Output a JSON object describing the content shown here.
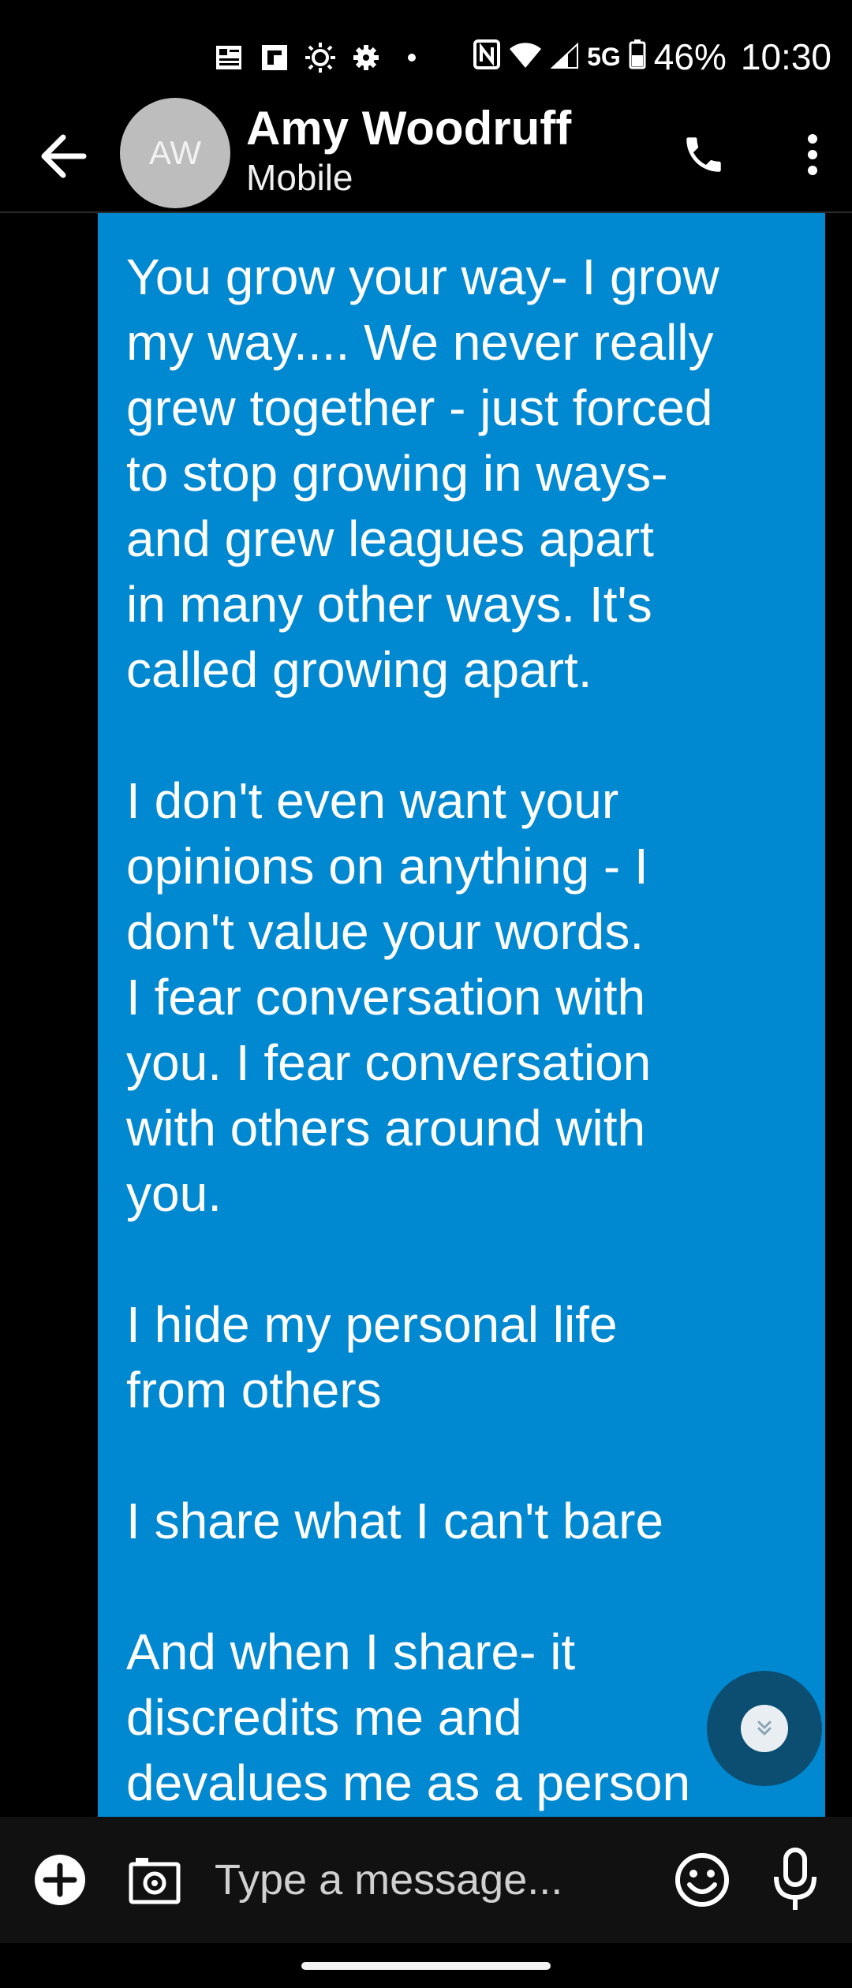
{
  "status_bar": {
    "network": "5G",
    "battery": "46%",
    "time": "10:30",
    "icons": [
      "news-icon",
      "flipboard-icon",
      "brightness-icon",
      "settings-icon",
      "dot-icon",
      "nfc-icon",
      "wifi-icon",
      "signal-icon",
      "battery-icon"
    ]
  },
  "header": {
    "avatar_initials": "AW",
    "contact_name": "Amy Woodruff",
    "contact_subtitle": "Mobile",
    "icons": [
      "back-arrow-icon",
      "phone-icon",
      "more-vert-icon"
    ]
  },
  "conversation": {
    "bubble_color": "#0088d1",
    "message_text": "You grow your way- I grow\nmy way.... We never really\ngrew together - just forced\nto stop growing in ways-\nand grew leagues apart\nin many other ways. It's\ncalled growing apart.\n\nI don't even want your\nopinions on anything - I\ndon't value your words.\nI fear conversation with\nyou. I fear conversation\nwith others around with\nyou.\n\nI hide my personal life\nfrom others\n\nI share what I can't bare\n\nAnd when I share- it\ndiscredits me and\ndevalues me as a person"
  },
  "scroll_fab": {
    "icon": "chevron-double-down-icon"
  },
  "composer": {
    "placeholder": "Type a message...",
    "icons": [
      "add-circle-icon",
      "camera-icon",
      "emoji-icon",
      "mic-icon"
    ]
  }
}
